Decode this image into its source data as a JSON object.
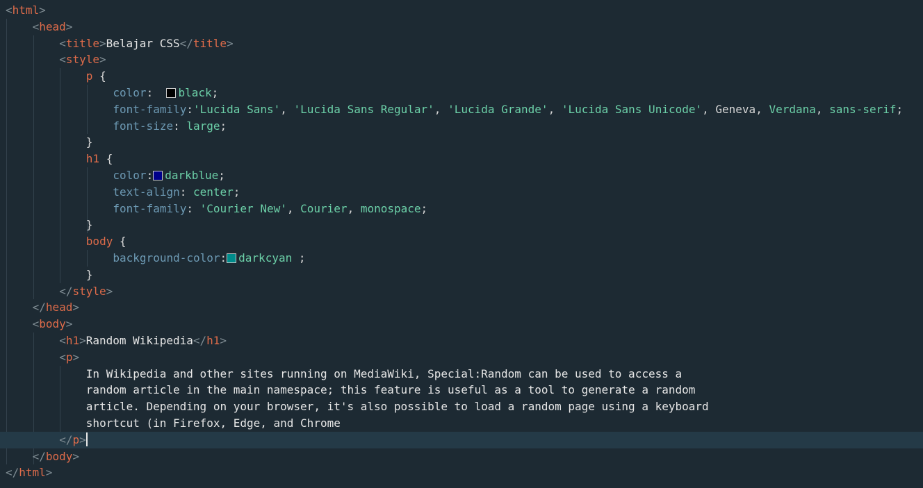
{
  "colors": {
    "black": "#000000",
    "darkblue": "#00008b",
    "darkcyan": "#008b8b"
  },
  "lines": [
    {
      "indent": 0,
      "tokens": [
        {
          "c": "br",
          "t": "<"
        },
        {
          "c": "tag",
          "t": "html"
        },
        {
          "c": "br",
          "t": ">"
        }
      ]
    },
    {
      "indent": 1,
      "tokens": [
        {
          "c": "br",
          "t": "<"
        },
        {
          "c": "tag",
          "t": "head"
        },
        {
          "c": "br",
          "t": ">"
        }
      ]
    },
    {
      "indent": 2,
      "tokens": [
        {
          "c": "br",
          "t": "<"
        },
        {
          "c": "tag",
          "t": "title"
        },
        {
          "c": "br",
          "t": ">"
        },
        {
          "c": "txt",
          "t": "Belajar CSS"
        },
        {
          "c": "br",
          "t": "</"
        },
        {
          "c": "tag",
          "t": "title"
        },
        {
          "c": "br",
          "t": ">"
        }
      ]
    },
    {
      "indent": 2,
      "tokens": [
        {
          "c": "br",
          "t": "<"
        },
        {
          "c": "tag",
          "t": "style"
        },
        {
          "c": "br",
          "t": ">"
        }
      ]
    },
    {
      "indent": 3,
      "tokens": [
        {
          "c": "tag",
          "t": "p"
        },
        {
          "c": "pun",
          "t": " {"
        }
      ]
    },
    {
      "indent": 4,
      "tokens": [
        {
          "c": "prop",
          "t": "color"
        },
        {
          "c": "pun",
          "t": ":  "
        },
        {
          "c": "swatch",
          "color": "black"
        },
        {
          "c": "val",
          "t": "black"
        },
        {
          "c": "pun",
          "t": ";"
        }
      ]
    },
    {
      "indent": 4,
      "tokens": [
        {
          "c": "prop",
          "t": "font-family"
        },
        {
          "c": "pun",
          "t": ":"
        },
        {
          "c": "val",
          "t": "'Lucida Sans'"
        },
        {
          "c": "pun",
          "t": ", "
        },
        {
          "c": "val",
          "t": "'Lucida Sans Regular'"
        },
        {
          "c": "pun",
          "t": ", "
        },
        {
          "c": "val",
          "t": "'Lucida Grande'"
        },
        {
          "c": "pun",
          "t": ", "
        },
        {
          "c": "val",
          "t": "'Lucida Sans Unicode'"
        },
        {
          "c": "pun",
          "t": ", Geneva, "
        },
        {
          "c": "val",
          "t": "Verdana"
        },
        {
          "c": "pun",
          "t": ", "
        },
        {
          "c": "val",
          "t": "sans-serif"
        },
        {
          "c": "pun",
          "t": ";"
        }
      ]
    },
    {
      "indent": 4,
      "tokens": [
        {
          "c": "prop",
          "t": "font-size"
        },
        {
          "c": "pun",
          "t": ": "
        },
        {
          "c": "val",
          "t": "large"
        },
        {
          "c": "pun",
          "t": ";"
        }
      ]
    },
    {
      "indent": 3,
      "tokens": [
        {
          "c": "pun",
          "t": "}"
        }
      ]
    },
    {
      "indent": 3,
      "tokens": [
        {
          "c": "tag",
          "t": "h1"
        },
        {
          "c": "pun",
          "t": " {"
        }
      ]
    },
    {
      "indent": 4,
      "tokens": [
        {
          "c": "prop",
          "t": "color"
        },
        {
          "c": "pun",
          "t": ":"
        },
        {
          "c": "swatch",
          "color": "darkblue"
        },
        {
          "c": "val",
          "t": "darkblue"
        },
        {
          "c": "pun",
          "t": ";"
        }
      ]
    },
    {
      "indent": 4,
      "tokens": [
        {
          "c": "prop",
          "t": "text-align"
        },
        {
          "c": "pun",
          "t": ": "
        },
        {
          "c": "val",
          "t": "center"
        },
        {
          "c": "pun",
          "t": ";"
        }
      ]
    },
    {
      "indent": 4,
      "tokens": [
        {
          "c": "prop",
          "t": "font-family"
        },
        {
          "c": "pun",
          "t": ": "
        },
        {
          "c": "val",
          "t": "'Courier New'"
        },
        {
          "c": "pun",
          "t": ", "
        },
        {
          "c": "val",
          "t": "Courier"
        },
        {
          "c": "pun",
          "t": ", "
        },
        {
          "c": "val",
          "t": "monospace"
        },
        {
          "c": "pun",
          "t": ";"
        }
      ]
    },
    {
      "indent": 3,
      "tokens": [
        {
          "c": "pun",
          "t": "}"
        }
      ]
    },
    {
      "indent": 3,
      "tokens": [
        {
          "c": "tag",
          "t": "body"
        },
        {
          "c": "pun",
          "t": " {"
        }
      ]
    },
    {
      "indent": 4,
      "tokens": [
        {
          "c": "prop",
          "t": "background-color"
        },
        {
          "c": "pun",
          "t": ":"
        },
        {
          "c": "swatch",
          "color": "darkcyan"
        },
        {
          "c": "val",
          "t": "darkcyan"
        },
        {
          "c": "pun",
          "t": " ;"
        }
      ]
    },
    {
      "indent": 3,
      "tokens": [
        {
          "c": "pun",
          "t": "}"
        }
      ]
    },
    {
      "indent": 2,
      "tokens": [
        {
          "c": "br",
          "t": "</"
        },
        {
          "c": "tag",
          "t": "style"
        },
        {
          "c": "br",
          "t": ">"
        }
      ]
    },
    {
      "indent": 1,
      "tokens": [
        {
          "c": "br",
          "t": "</"
        },
        {
          "c": "tag",
          "t": "head"
        },
        {
          "c": "br",
          "t": ">"
        }
      ]
    },
    {
      "indent": 1,
      "tokens": [
        {
          "c": "br",
          "t": "<"
        },
        {
          "c": "tag",
          "t": "body"
        },
        {
          "c": "br",
          "t": ">"
        }
      ]
    },
    {
      "indent": 2,
      "tokens": [
        {
          "c": "br",
          "t": "<"
        },
        {
          "c": "tag",
          "t": "h1"
        },
        {
          "c": "br",
          "t": ">"
        },
        {
          "c": "txt",
          "t": "Random Wikipedia"
        },
        {
          "c": "br",
          "t": "</"
        },
        {
          "c": "tag",
          "t": "h1"
        },
        {
          "c": "br",
          "t": ">"
        }
      ]
    },
    {
      "indent": 2,
      "tokens": [
        {
          "c": "br",
          "t": "<"
        },
        {
          "c": "tag",
          "t": "p"
        },
        {
          "c": "br",
          "t": ">"
        }
      ]
    },
    {
      "indent": 3,
      "tokens": [
        {
          "c": "txt",
          "t": "In Wikipedia and other sites running on MediaWiki, Special:Random can be used to access a"
        }
      ]
    },
    {
      "indent": 3,
      "tokens": [
        {
          "c": "txt",
          "t": "random article in the main namespace; this feature is useful as a tool to generate a random"
        }
      ]
    },
    {
      "indent": 3,
      "tokens": [
        {
          "c": "txt",
          "t": "article. Depending on your browser, it's also possible to load a random page using a keyboard"
        }
      ]
    },
    {
      "indent": 3,
      "tokens": [
        {
          "c": "txt",
          "t": "shortcut (in Firefox, Edge, and Chrome"
        }
      ]
    },
    {
      "indent": 2,
      "current": true,
      "tokens": [
        {
          "c": "br",
          "t": "</"
        },
        {
          "c": "tag",
          "t": "p"
        },
        {
          "c": "br",
          "t": ">"
        }
      ]
    },
    {
      "indent": 1,
      "tokens": [
        {
          "c": "br",
          "t": "</"
        },
        {
          "c": "tag",
          "t": "body"
        },
        {
          "c": "br",
          "t": ">"
        }
      ]
    },
    {
      "indent": 0,
      "tokens": [
        {
          "c": "br",
          "t": "</"
        },
        {
          "c": "tag",
          "t": "html"
        },
        {
          "c": "br",
          "t": ">"
        }
      ]
    }
  ]
}
